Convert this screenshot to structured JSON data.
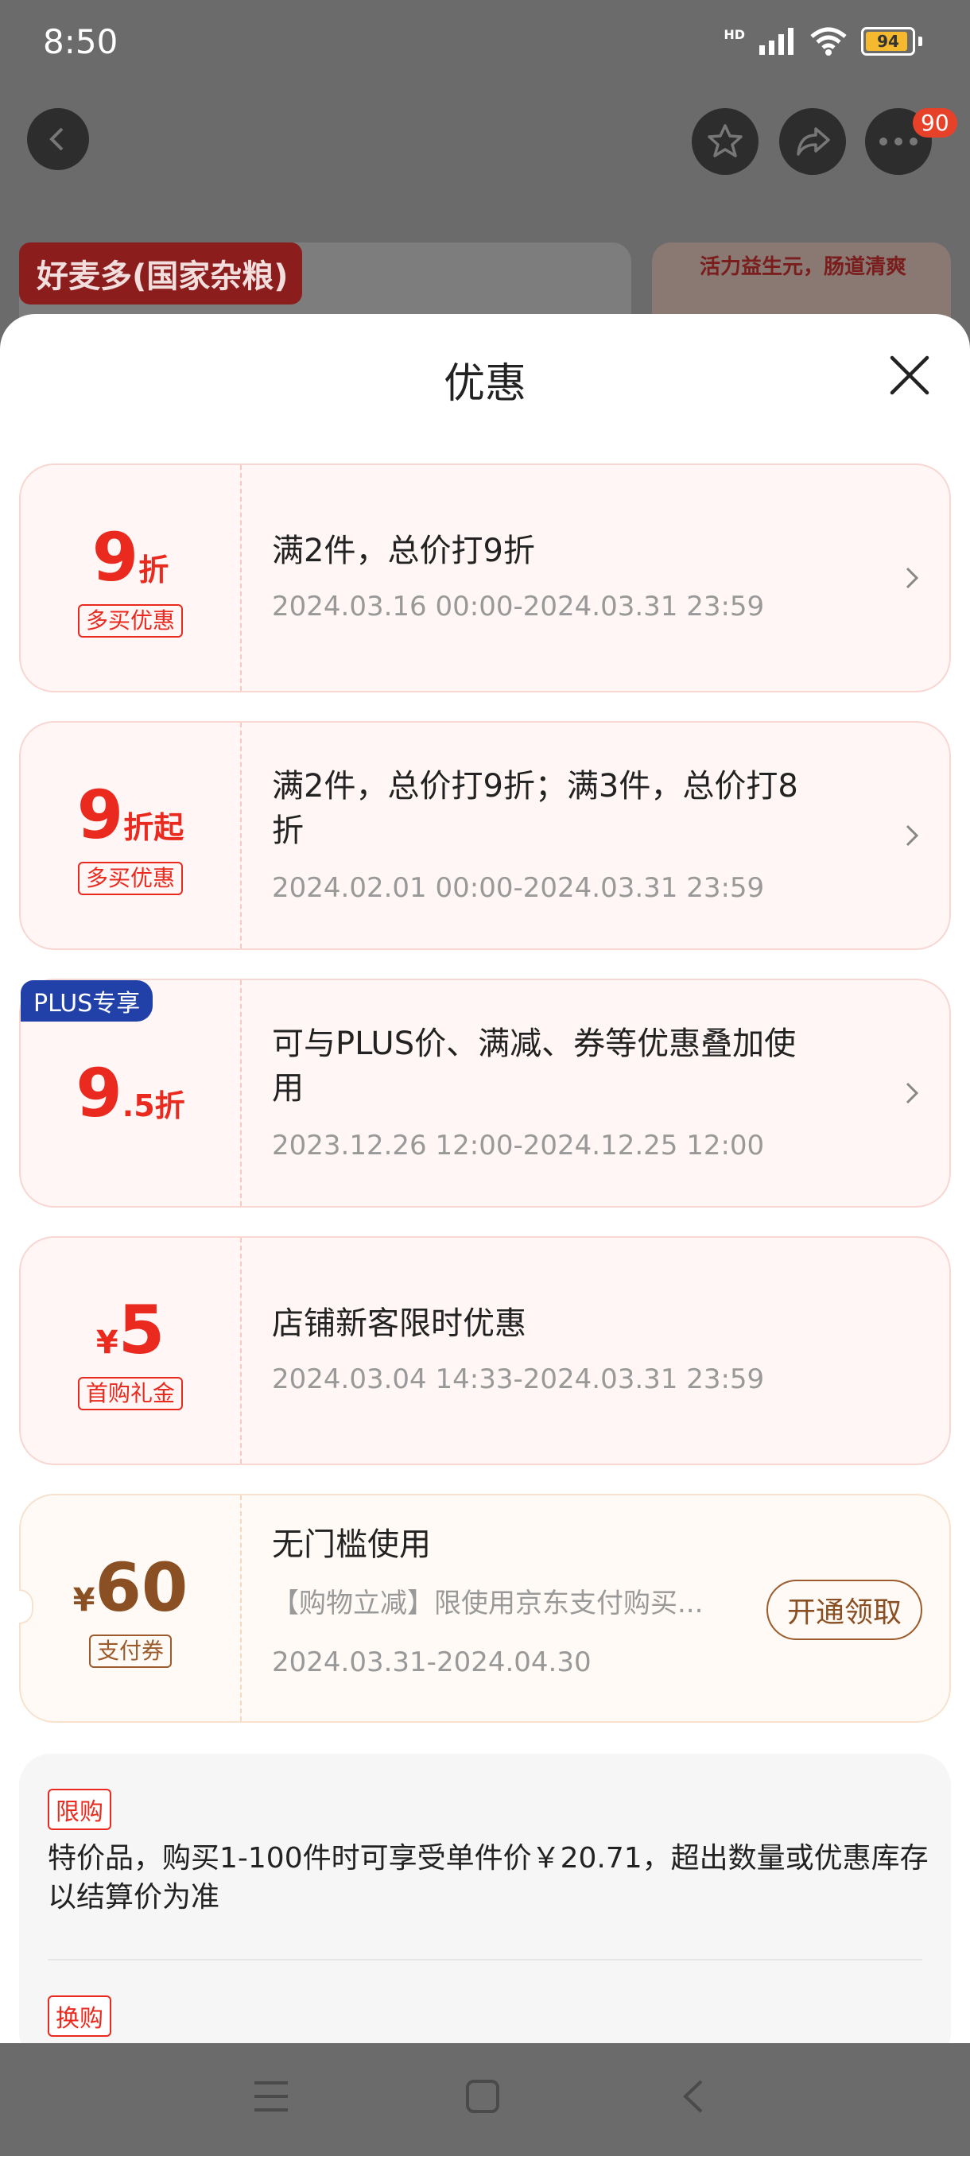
{
  "status_bar": {
    "time": "8:50",
    "network": "HD",
    "battery": "94"
  },
  "header": {
    "badge_count": "90"
  },
  "background": {
    "brand_logo": "好麦多(国家杂粮)",
    "promo_text": "活力益生元，肠道清爽"
  },
  "sheet": {
    "title": "优惠"
  },
  "coupons": [
    {
      "value": "9",
      "unit": "折",
      "tag": "多买优惠",
      "desc": "满2件，总价打9折",
      "date": "2024.03.16 00:00-2024.03.31 23:59"
    },
    {
      "value": "9",
      "unit": "折起",
      "tag": "多买优惠",
      "desc": "满2件，总价打9折；满3件，总价打8折",
      "date": "2024.02.01 00:00-2024.03.31 23:59"
    },
    {
      "value": "9",
      "value_dec": ".5",
      "unit": "折",
      "badge": "PLUS专享",
      "desc": "可与PLUS价、满减、券等优惠叠加使用",
      "date": "2023.12.26 12:00-2024.12.25 12:00"
    },
    {
      "currency": "¥",
      "value": "5",
      "tag": "首购礼金",
      "desc": "店铺新客限时优惠",
      "date": "2024.03.04 14:33-2024.03.31 23:59"
    },
    {
      "currency": "¥",
      "value": "60",
      "tag": "支付券",
      "desc": "无门槛使用",
      "subdesc": "【购物立减】限使用京东支付购买...",
      "date": "2024.03.31-2024.04.30",
      "button": "开通领取"
    }
  ],
  "info": {
    "tag1": "限购",
    "text1": "特价品，购买1-100件时可享受单件价￥20.71，超出数量或优惠库存以结算价为准",
    "tag2": "换购"
  },
  "colors": {
    "accent_red": "#ea2a1f",
    "plus_blue": "#2241a8",
    "brown": "#9b5b2c"
  }
}
